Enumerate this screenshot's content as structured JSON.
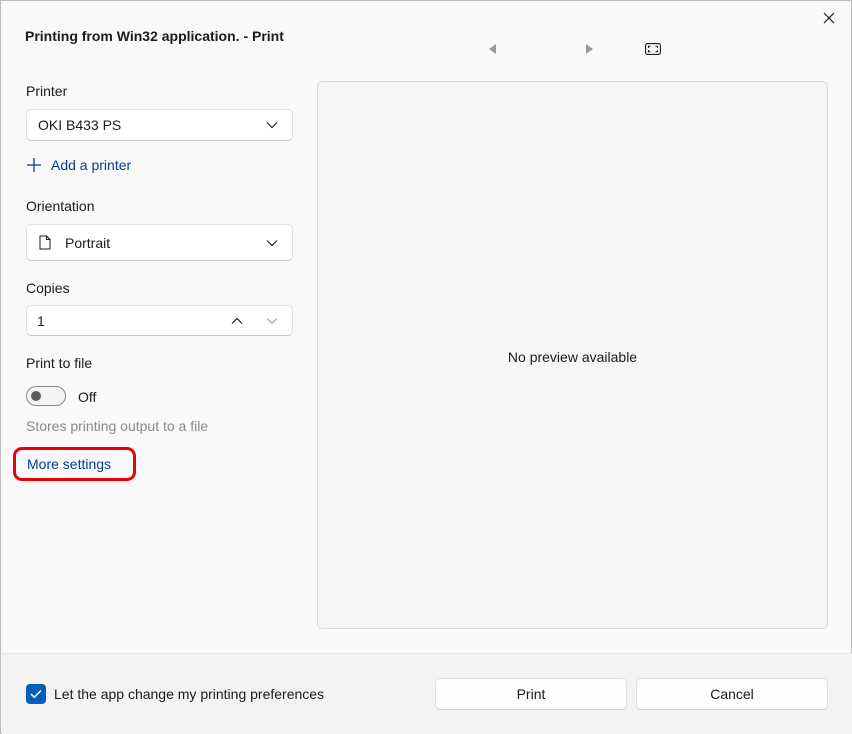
{
  "window": {
    "title": "Printing from Win32 application. - Print"
  },
  "printer": {
    "label": "Printer",
    "selected": "OKI B433 PS",
    "add_printer_label": "Add a printer"
  },
  "orientation": {
    "label": "Orientation",
    "selected": "Portrait"
  },
  "copies": {
    "label": "Copies",
    "value": "1"
  },
  "print_to_file": {
    "label": "Print to file",
    "state_label": "Off",
    "hint": "Stores printing output to a file"
  },
  "more_settings_label": "More settings",
  "preview": {
    "message": "No preview available"
  },
  "footer": {
    "checkbox_label": "Let the app change my printing preferences",
    "checkbox_checked": true,
    "print_label": "Print",
    "cancel_label": "Cancel"
  },
  "colors": {
    "accent": "#005fb8",
    "link": "#003e92",
    "highlight": "#e8000b"
  },
  "icons": [
    "close-icon",
    "previous-page-icon",
    "next-page-icon",
    "fit-to-window-icon",
    "plus-icon",
    "chevron-down-icon",
    "document-icon",
    "chevron-up-icon",
    "checkmark-icon"
  ]
}
